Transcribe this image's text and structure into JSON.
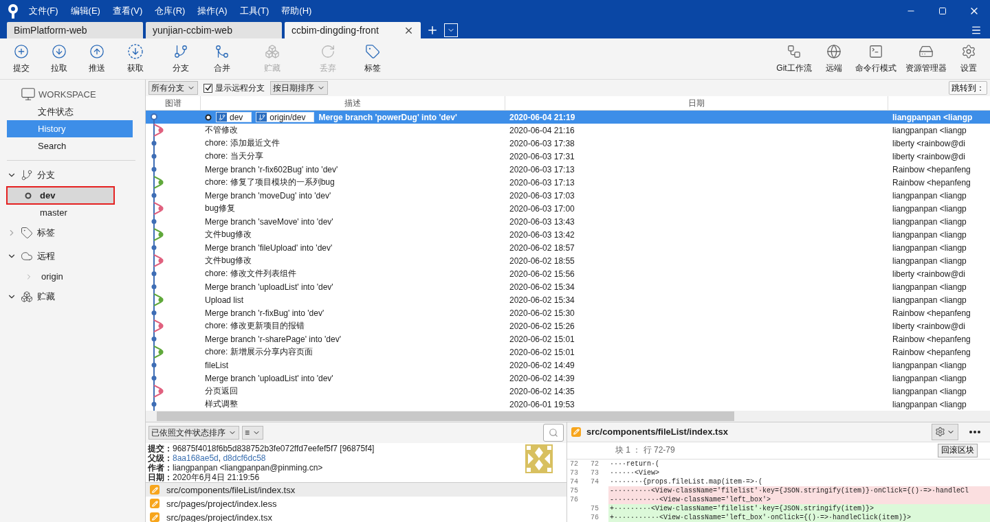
{
  "menu": [
    "文件(F)",
    "编辑(E)",
    "查看(V)",
    "仓库(R)",
    "操作(A)",
    "工具(T)",
    "帮助(H)"
  ],
  "tabs": [
    {
      "label": "BimPlatform-web",
      "selected": false
    },
    {
      "label": "yunjian-ccbim-web",
      "selected": false
    },
    {
      "label": "ccbim-dingding-front",
      "selected": true
    }
  ],
  "toolbar_left": [
    {
      "label": "提交",
      "disabled": false
    },
    {
      "label": "拉取",
      "disabled": false
    },
    {
      "label": "推送",
      "disabled": false
    },
    {
      "label": "获取",
      "disabled": false
    },
    {
      "label": "分支",
      "disabled": false
    },
    {
      "label": "合并",
      "disabled": false
    },
    {
      "label": "贮藏",
      "disabled": true
    },
    {
      "label": "丢弃",
      "disabled": true
    },
    {
      "label": "标签",
      "disabled": false
    }
  ],
  "toolbar_right": [
    {
      "label": "Git工作流"
    },
    {
      "label": "远端"
    },
    {
      "label": "命令行模式"
    },
    {
      "label": "资源管理器"
    },
    {
      "label": "设置"
    }
  ],
  "sidebar": {
    "workspace": "WORKSPACE",
    "items": [
      {
        "label": "文件状态",
        "selected": false
      },
      {
        "label": "History",
        "selected": true
      },
      {
        "label": "Search",
        "selected": false
      }
    ],
    "sections": [
      {
        "label": "分支",
        "expanded": true,
        "children": [
          {
            "label": "dev",
            "current": true,
            "highlighted": true
          },
          {
            "label": "master",
            "current": false,
            "highlighted": false
          }
        ]
      },
      {
        "label": "标签",
        "expanded": false
      },
      {
        "label": "远程",
        "expanded": true,
        "children": [
          {
            "label": "origin",
            "expanded": false
          }
        ]
      },
      {
        "label": "贮藏",
        "expanded": true
      }
    ]
  },
  "filters": {
    "branches": "所有分支",
    "show_remote": {
      "label": "显示远程分支",
      "checked": true
    },
    "sort": "按日期排序",
    "jump": "跳转到："
  },
  "table": {
    "columns": [
      "图谱",
      "描述",
      "日期"
    ],
    "rows": [
      {
        "kind": "head",
        "color": "#3d6db5",
        "selected": true,
        "refs": [
          "dev",
          "origin/dev"
        ],
        "description": "Merge branch 'powerDug' into 'dev'",
        "date": "2020-06-04 21:19",
        "author": "liangpanpan <liangp"
      },
      {
        "kind": "side",
        "color": "#e0607e",
        "selected": false,
        "description": "不管修改",
        "date": "2020-06-04 21:16",
        "author": "liangpanpan <liangp"
      },
      {
        "kind": "main",
        "color": "#3d6db5",
        "selected": false,
        "description": "chore: 添加最近文件",
        "date": "2020-06-03 17:38",
        "author": "liberty <rainbow@di"
      },
      {
        "kind": "main",
        "color": "#3d6db5",
        "selected": false,
        "description": "chore: 当天分享",
        "date": "2020-06-03 17:31",
        "author": "liberty <rainbow@di"
      },
      {
        "kind": "main",
        "color": "#3d6db5",
        "selected": false,
        "description": "Merge branch 'r-fix602Bug' into 'dev'",
        "date": "2020-06-03 17:13",
        "author": "Rainbow <hepanfeng"
      },
      {
        "kind": "side",
        "color": "#5fa83a",
        "selected": false,
        "description": "chore: 修复了项目模块的一系列bug",
        "date": "2020-06-03 17:13",
        "author": "Rainbow <hepanfeng"
      },
      {
        "kind": "main",
        "color": "#3d6db5",
        "selected": false,
        "description": "Merge branch 'moveDug' into 'dev'",
        "date": "2020-06-03 17:03",
        "author": "liangpanpan <liangp"
      },
      {
        "kind": "side",
        "color": "#e0607e",
        "selected": false,
        "description": "bug修复",
        "date": "2020-06-03 17:00",
        "author": "liangpanpan <liangp"
      },
      {
        "kind": "main",
        "color": "#3d6db5",
        "selected": false,
        "description": "Merge branch 'saveMove' into 'dev'",
        "date": "2020-06-03 13:43",
        "author": "liangpanpan <liangp"
      },
      {
        "kind": "side",
        "color": "#5fa83a",
        "selected": false,
        "description": "文件bug修改",
        "date": "2020-06-03 13:42",
        "author": "liangpanpan <liangp"
      },
      {
        "kind": "main",
        "color": "#3d6db5",
        "selected": false,
        "description": "Merge branch 'fileUpload' into 'dev'",
        "date": "2020-06-02 18:57",
        "author": "liangpanpan <liangp"
      },
      {
        "kind": "side",
        "color": "#e0607e",
        "selected": false,
        "description": "文件bug修改",
        "date": "2020-06-02 18:55",
        "author": "liangpanpan <liangp"
      },
      {
        "kind": "main",
        "color": "#3d6db5",
        "selected": false,
        "description": "chore: 修改文件列表组件",
        "date": "2020-06-02 15:56",
        "author": "liberty <rainbow@di"
      },
      {
        "kind": "main",
        "color": "#3d6db5",
        "selected": false,
        "description": "Merge branch 'uploadList' into 'dev'",
        "date": "2020-06-02 15:34",
        "author": "liangpanpan <liangp"
      },
      {
        "kind": "side",
        "color": "#5fa83a",
        "selected": false,
        "description": "Upload list",
        "date": "2020-06-02 15:34",
        "author": "liangpanpan <liangp"
      },
      {
        "kind": "main",
        "color": "#3d6db5",
        "selected": false,
        "description": "Merge branch 'r-fixBug' into 'dev'",
        "date": "2020-06-02 15:30",
        "author": "Rainbow <hepanfeng"
      },
      {
        "kind": "side",
        "color": "#e0607e",
        "selected": false,
        "description": "chore: 修改更新项目的报错",
        "date": "2020-06-02 15:26",
        "author": "liberty <rainbow@di"
      },
      {
        "kind": "main",
        "color": "#3d6db5",
        "selected": false,
        "description": "Merge branch 'r-sharePage' into 'dev'",
        "date": "2020-06-02 15:01",
        "author": "Rainbow <hepanfeng"
      },
      {
        "kind": "side",
        "color": "#5fa83a",
        "selected": false,
        "description": "chore: 新增展示分享内容页面",
        "date": "2020-06-02 15:01",
        "author": "Rainbow <hepanfeng"
      },
      {
        "kind": "main",
        "color": "#3d6db5",
        "selected": false,
        "description": "fileList",
        "date": "2020-06-02 14:49",
        "author": "liangpanpan <liangp"
      },
      {
        "kind": "main",
        "color": "#3d6db5",
        "selected": false,
        "description": "Merge branch 'uploadList' into 'dev'",
        "date": "2020-06-02 14:39",
        "author": "liangpanpan <liangp"
      },
      {
        "kind": "side",
        "color": "#e0607e",
        "selected": false,
        "description": "分页返回",
        "date": "2020-06-02 14:35",
        "author": "liangpanpan <liangp"
      },
      {
        "kind": "main",
        "color": "#3d6db5",
        "selected": false,
        "description": "样式调整",
        "date": "2020-06-01 19:53",
        "author": "liangpanpan <liangp"
      }
    ]
  },
  "file_panel": {
    "sort": "已依照文件状态排序",
    "view": "≡",
    "details": [
      {
        "label": "提交：",
        "value": "96875f4018f6b5d838752b3fe072ffd7eefef5f7 [96875f4]"
      },
      {
        "label": "父级：",
        "links": [
          "8aa168ae5d",
          "d8dcf6dc58"
        ],
        "separator": ","
      },
      {
        "label": "作者：",
        "value": "liangpanpan <liangpanpan@pinming.cn>"
      },
      {
        "label": "日期：",
        "value": "2020年6月4日 21:19:56"
      }
    ],
    "files": [
      {
        "path": "src/components/fileList/index.tsx",
        "selected": true
      },
      {
        "path": "src/pages/project/index.less",
        "selected": false
      },
      {
        "path": "src/pages/project/index.tsx",
        "selected": false
      }
    ]
  },
  "diff": {
    "file": "src/components/fileList/index.tsx",
    "hunk": "块 1 ： 行 72-79",
    "revert": "回滚区块",
    "lines": [
      {
        "kind": "context",
        "old": "72",
        "new": "72",
        "text": "····return·("
      },
      {
        "kind": "context",
        "old": "73",
        "new": "73",
        "text": "······<View>"
      },
      {
        "kind": "context",
        "old": "74",
        "new": "74",
        "text": "········{props.fileList.map(item·=>·("
      },
      {
        "kind": "removed",
        "old": "75",
        "text": "-·········<View·className='filelist'·key={JSON.stringify(item)}·onClick={()·=>·handleCl"
      },
      {
        "kind": "removed",
        "old": "76",
        "text": "-···········<View·className='left_box'>"
      },
      {
        "kind": "added",
        "new": "75",
        "text": "+·········<View·className='filelist'·key={JSON.stringify(item)}>"
      },
      {
        "kind": "added",
        "new": "76",
        "text": "+···········<View·className='left_box'·onClick={()·=>·handleClick(item)}>"
      }
    ]
  }
}
